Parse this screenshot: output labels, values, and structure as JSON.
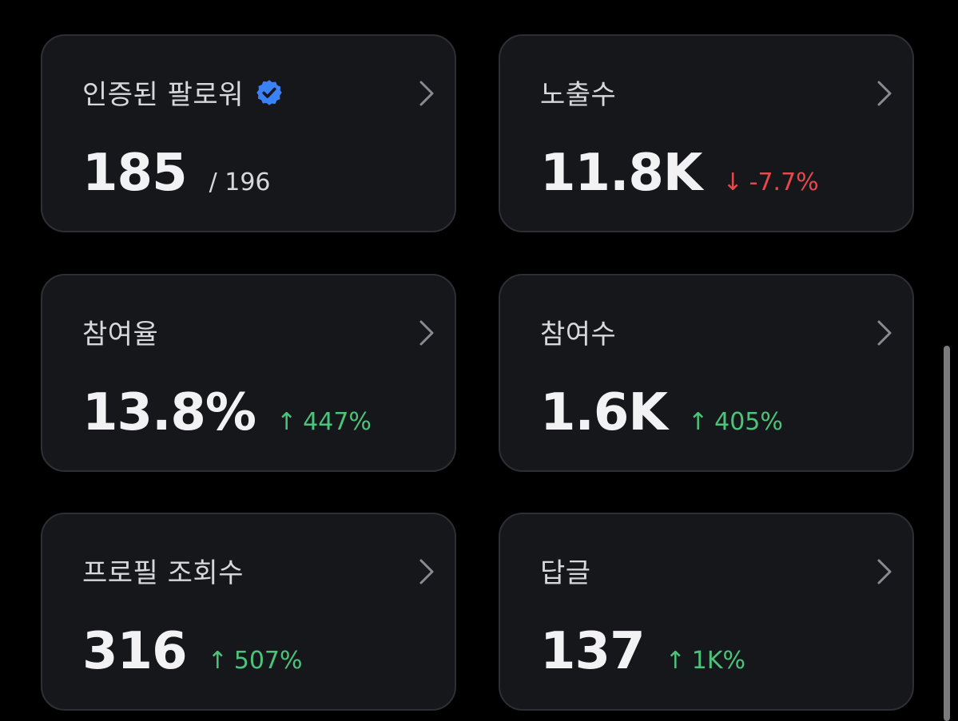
{
  "cards": [
    {
      "title": "인증된 팔로워",
      "value": "185",
      "total": "/ 196",
      "verified": true,
      "accent_color": "#3b82f6"
    },
    {
      "title": "노출수",
      "value": "11.8K",
      "delta_arrow": "↓",
      "delta_text": "-7.7%",
      "delta_direction": "down",
      "delta_color": "#e5484d"
    },
    {
      "title": "참여율",
      "value": "13.8%",
      "delta_arrow": "↑",
      "delta_text": "447%",
      "delta_direction": "up",
      "delta_color": "#4cc37a"
    },
    {
      "title": "참여수",
      "value": "1.6K",
      "delta_arrow": "↑",
      "delta_text": "405%",
      "delta_direction": "up",
      "delta_color": "#4cc37a"
    },
    {
      "title": "프로필 조회수",
      "value": "316",
      "delta_arrow": "↑",
      "delta_text": "507%",
      "delta_direction": "up",
      "delta_color": "#4cc37a"
    },
    {
      "title": "답글",
      "value": "137",
      "delta_arrow": "↑",
      "delta_text": "1K%",
      "delta_direction": "up",
      "delta_color": "#4cc37a"
    }
  ],
  "icons": {
    "verified": "verified-badge-icon",
    "chevron": "chevron-right-icon"
  }
}
